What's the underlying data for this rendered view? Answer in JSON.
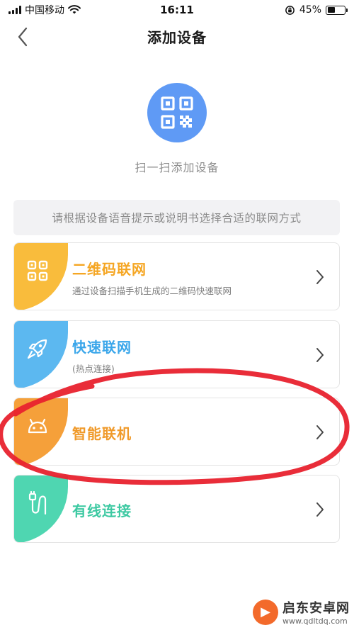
{
  "status_bar": {
    "carrier": "中国移动",
    "time": "16:11",
    "battery_text": "45%",
    "battery_level": 0.45
  },
  "nav": {
    "title": "添加设备"
  },
  "scan": {
    "label": "扫一扫添加设备",
    "icon": "qr-code-icon"
  },
  "hint": "请根据设备语音提示或说明书选择合适的联网方式",
  "options": [
    {
      "title": "二维码联网",
      "subtitle": "通过设备扫描手机生成的二维码快速联网",
      "color": "#f9bc3c",
      "icon": "qr-grid-icon"
    },
    {
      "title": "快速联网",
      "subtitle": "(热点连接)",
      "color": "#5cb8f0",
      "icon": "rocket-icon"
    },
    {
      "title": "智能联机",
      "subtitle": "",
      "color": "#f5a03a",
      "icon": "android-robot-icon"
    },
    {
      "title": "有线连接",
      "subtitle": "",
      "color": "#4fd6b1",
      "icon": "cable-plug-icon"
    }
  ],
  "annotation_color": "#e8222e",
  "watermark": {
    "name": "启东安卓网",
    "url": "www.qdltdq.com"
  }
}
